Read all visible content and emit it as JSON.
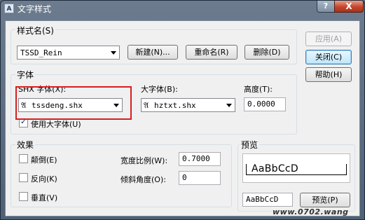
{
  "window": {
    "title": "文字样式",
    "title_icon": "app-icon",
    "help_glyph": "?",
    "close_glyph": "X"
  },
  "style_name": {
    "group_label": "样式名(S)",
    "value": "TSSD_Rein",
    "new_label": "新建(N)...",
    "rename_label": "重命名(R)",
    "delete_label": "删除(D)"
  },
  "side_buttons": {
    "apply": "应用(A)",
    "close": "关闭(C)",
    "help": "帮助(H)"
  },
  "font": {
    "group_label": "字体",
    "shx_label": "SHX 字体(X):",
    "shx_value": "tssdeng.shx",
    "big_label": "大字体(B):",
    "big_value": "hztxt.shx",
    "height_label": "高度(T):",
    "height_value": "0.0000",
    "use_big_label": "使用大字体(U)",
    "use_big_checked": true
  },
  "effects": {
    "group_label": "效果",
    "upside_down": "颠倒(E)",
    "backwards": "反向(K)",
    "vertical": "垂直(V)",
    "width_label": "宽度比例(W):",
    "width_value": "0.7000",
    "oblique_label": "倾斜角度(O):",
    "oblique_value": "0"
  },
  "preview": {
    "group_label": "预览",
    "sample_text": "AaBbCcD",
    "input_value": "AaBbCcD",
    "button_label": "预览(P)"
  },
  "watermark": "www.0702.wang",
  "colors": {
    "highlight": "#d71f1f",
    "title_close": "#c5462c"
  }
}
